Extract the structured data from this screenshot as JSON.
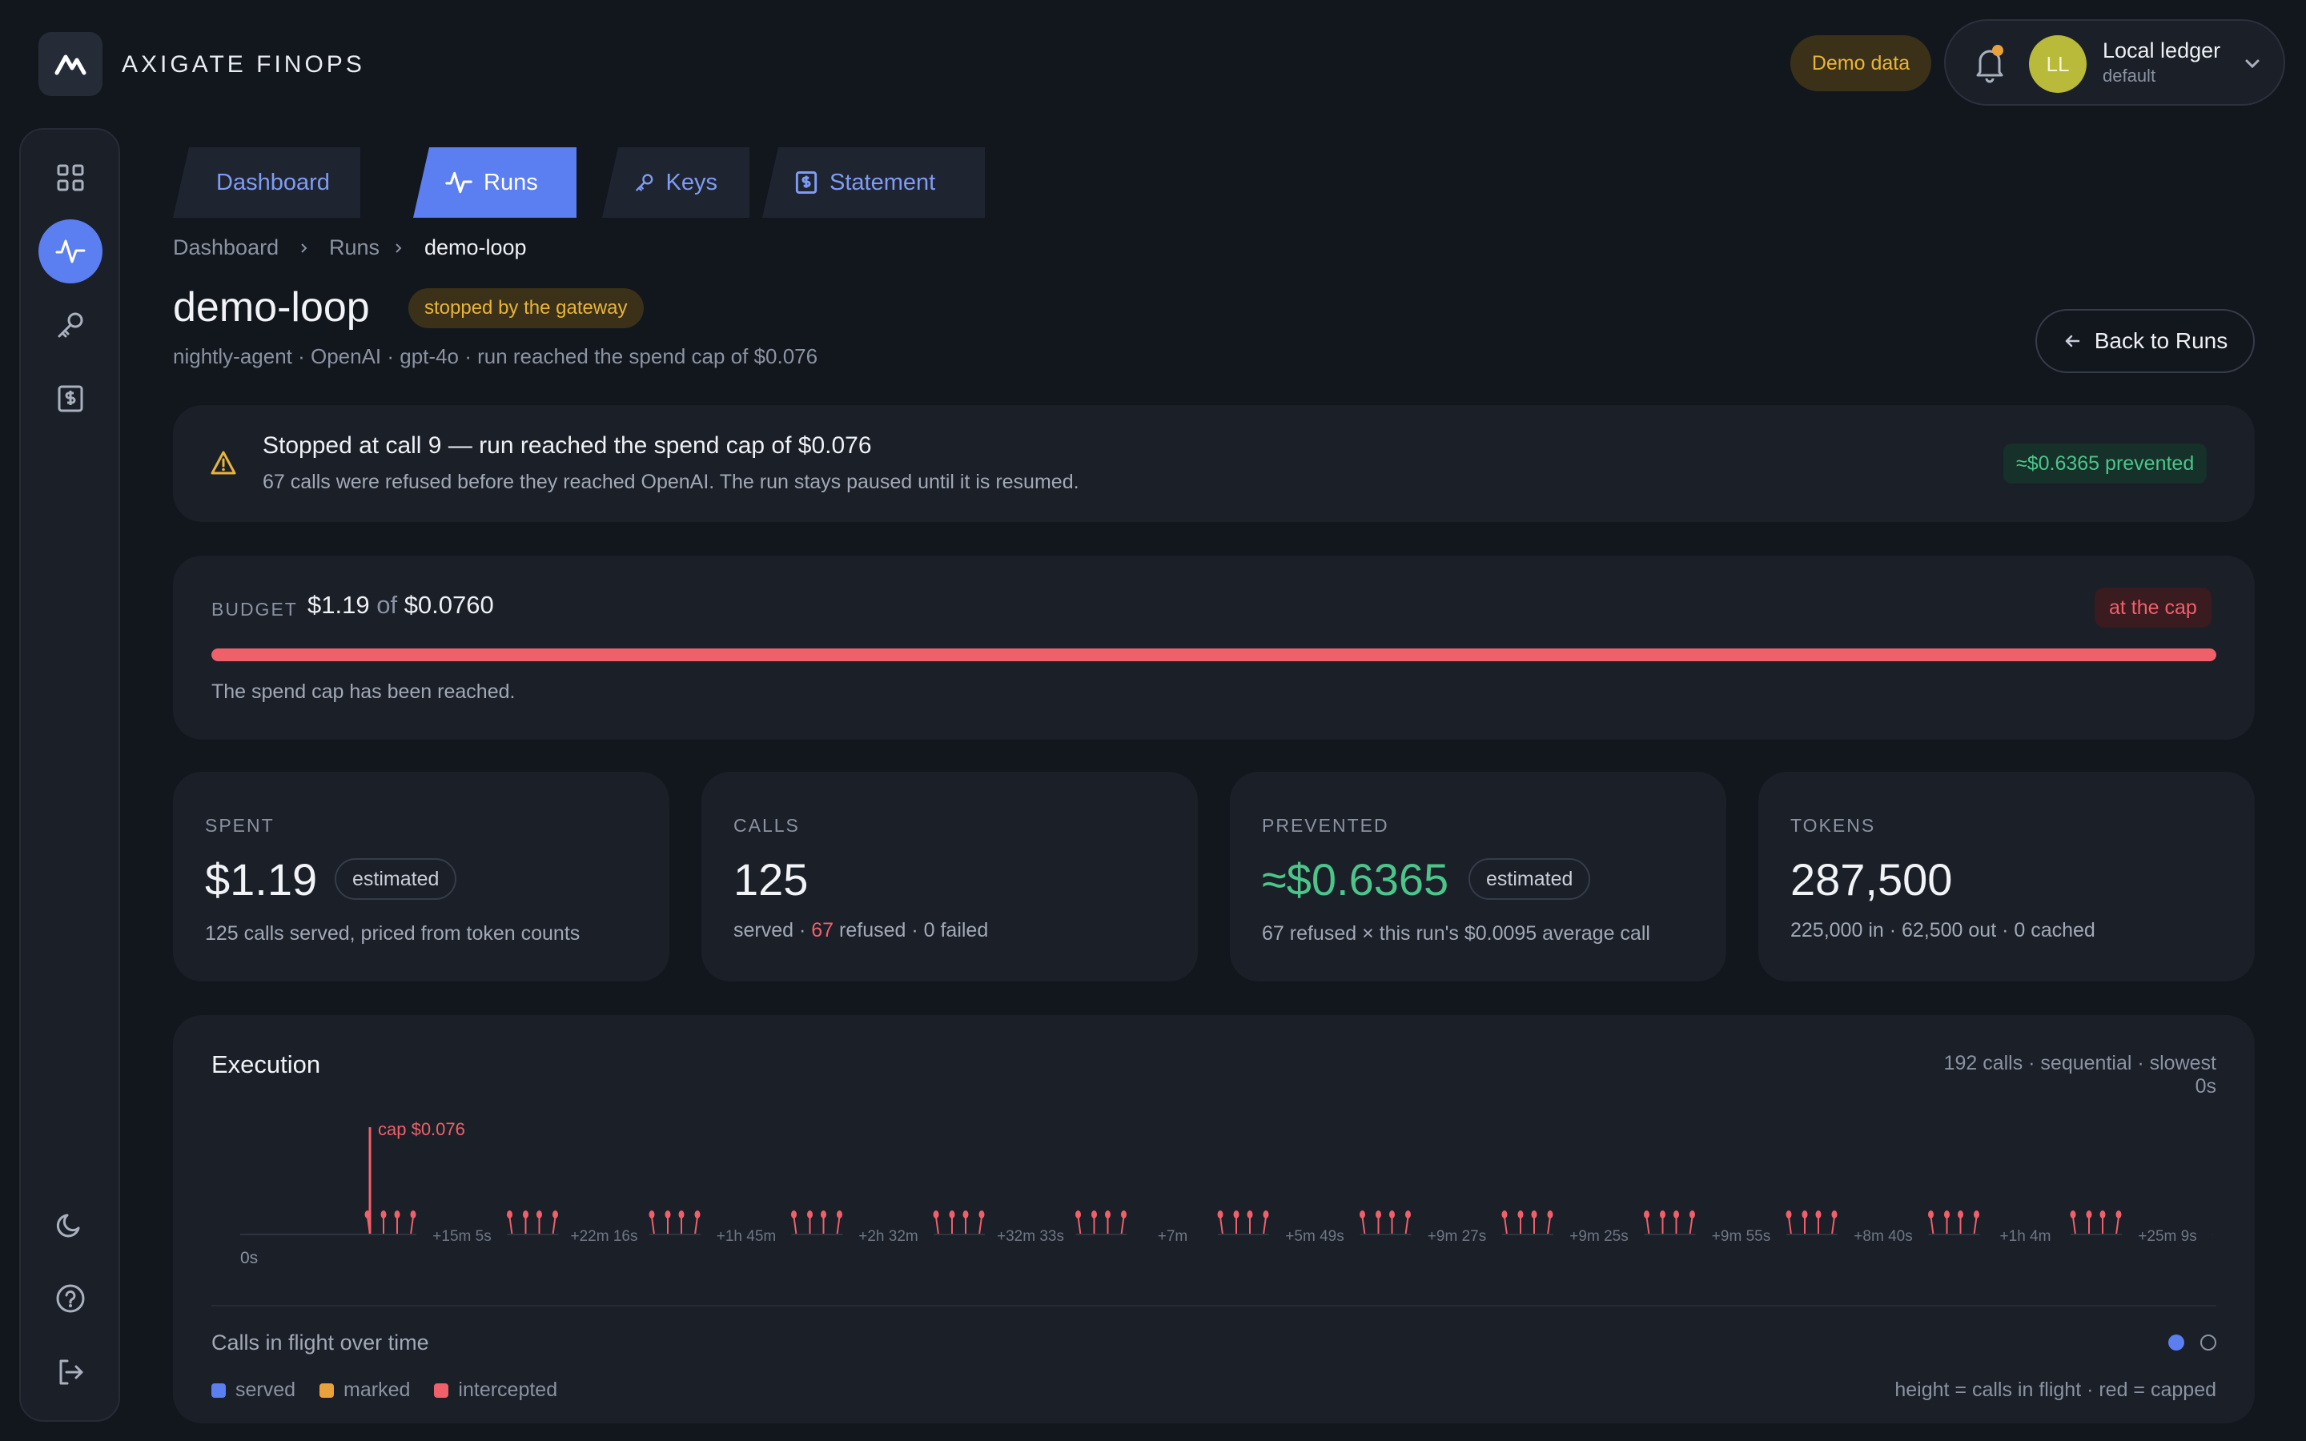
{
  "brand": "AXIGATE FINOPS",
  "header": {
    "demo_badge": "Demo data",
    "user_initials": "LL",
    "user_name": "Local ledger",
    "user_sub": "default"
  },
  "tabs": [
    {
      "label": "Dashboard",
      "icon": "grid-icon"
    },
    {
      "label": "Runs",
      "icon": "activity-icon",
      "active": true
    },
    {
      "label": "Keys",
      "icon": "key-icon"
    },
    {
      "label": "Statement",
      "icon": "statement-icon"
    }
  ],
  "breadcrumb": [
    "Dashboard",
    "Runs",
    "demo-loop"
  ],
  "run": {
    "title": "demo-loop",
    "status": "stopped by the gateway",
    "subtitle": "nightly-agent · OpenAI · gpt-4o · run reached the spend cap of $0.076",
    "back_label": "Back to Runs"
  },
  "alert": {
    "title": "Stopped at call 9 — run reached the spend cap of $0.076",
    "body": "67 calls were refused before they reached OpenAI. The run stays paused until it is resumed.",
    "badge": "≈$0.6365 prevented"
  },
  "budget": {
    "label": "BUDGET",
    "spent": "$1.19",
    "of": "of",
    "cap": "$0.0760",
    "badge": "at the cap",
    "fill_fraction": 1.0,
    "note": "The spend cap has been reached."
  },
  "stats": {
    "spent": {
      "label": "SPENT",
      "value": "$1.19",
      "pill": "estimated",
      "note": "125 calls served, priced from token counts"
    },
    "calls": {
      "label": "CALLS",
      "value": "125",
      "note_a": "served · ",
      "note_red": "67",
      "note_b": " refused · 0 failed"
    },
    "prevented": {
      "label": "PREVENTED",
      "value": "≈$0.6365",
      "pill": "estimated",
      "note": "67 refused × this run's $0.0095 average call"
    },
    "tokens": {
      "label": "TOKENS",
      "value": "287,500",
      "note": "225,000 in · 62,500 out · 0 cached"
    }
  },
  "execution": {
    "title": "Execution",
    "meta": "192 calls · sequential · slowest 0s",
    "cap_label": "cap $0.076",
    "start_label": "0s",
    "gap_labels": [
      "+15m 5s",
      "+22m 16s",
      "+1h 45m",
      "+2h 32m",
      "+32m 33s",
      "+7m",
      "+5m 49s",
      "+9m 27s",
      "+9m 25s",
      "+9m 55s",
      "+8m 40s",
      "+1h 4m",
      "+25m 9s"
    ],
    "flight_label": "Calls in flight over time",
    "legend": [
      {
        "label": "served",
        "color": "#5b7ef0"
      },
      {
        "label": "marked",
        "color": "#e9a23b"
      },
      {
        "label": "intercepted",
        "color": "#f0606a"
      }
    ],
    "legend_note": "height = calls in flight · red = capped"
  },
  "colors": {
    "accent": "#5b7ef0",
    "danger": "#f0606a",
    "success": "#4cc58a",
    "warn": "#e9b43a"
  }
}
